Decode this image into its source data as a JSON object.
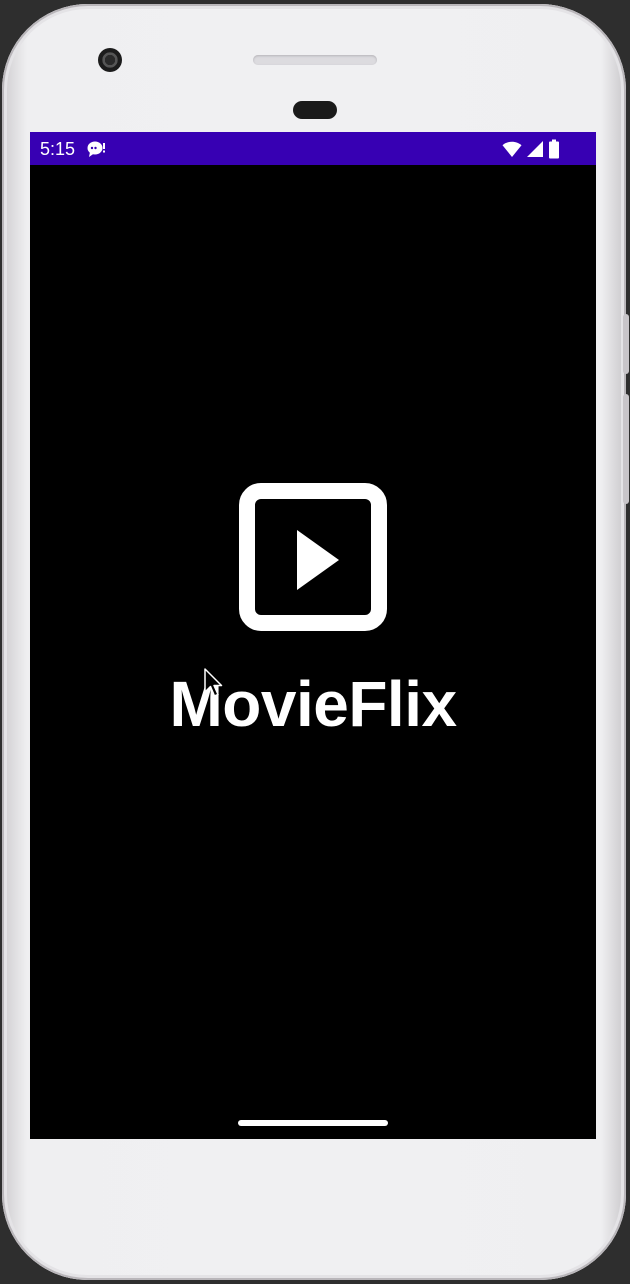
{
  "status_bar": {
    "time": "5:15",
    "background_color": "#3700b3",
    "left_icons": [
      "notification-icon"
    ],
    "right_icons": [
      "wifi-icon",
      "cellular-signal-icon",
      "battery-icon"
    ]
  },
  "splash": {
    "background_color": "#000000",
    "logo_icon": "play-box-icon",
    "app_name": "MovieFlix"
  },
  "device": {
    "frame_color": "#f0f0f2"
  }
}
